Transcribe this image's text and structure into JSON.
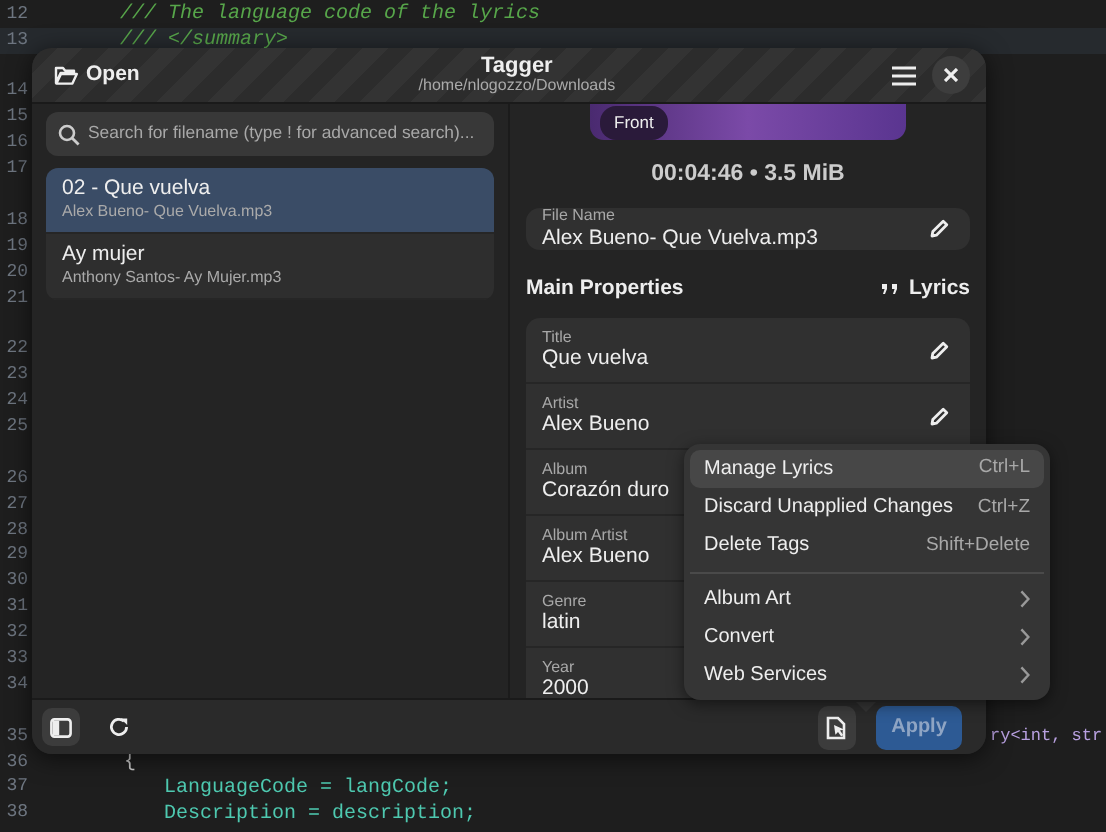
{
  "editor": {
    "lines": [
      {
        "kind": "comment",
        "number": "12",
        "code": "/// The language code of the lyrics",
        "current": false
      },
      {
        "kind": "summary",
        "number": "13",
        "code": "/// </summary>",
        "current": true
      },
      {
        "kind": "gap"
      },
      {
        "kind": "hidden",
        "number": "14"
      },
      {
        "kind": "hidden",
        "number": "15"
      },
      {
        "kind": "hidden",
        "number": "16"
      },
      {
        "kind": "hidden",
        "number": "17"
      },
      {
        "kind": "gap"
      },
      {
        "kind": "hidden",
        "number": "18"
      },
      {
        "kind": "hidden",
        "number": "19"
      },
      {
        "kind": "hidden",
        "number": "20"
      },
      {
        "kind": "hidden",
        "number": "21"
      },
      {
        "kind": "gap"
      },
      {
        "kind": "hidden",
        "number": "22"
      },
      {
        "kind": "hidden",
        "number": "23"
      },
      {
        "kind": "hidden",
        "number": "24"
      },
      {
        "kind": "hidden",
        "number": "25"
      },
      {
        "kind": "gap"
      },
      {
        "kind": "hidden",
        "number": "26"
      },
      {
        "kind": "hidden",
        "number": "27"
      },
      {
        "kind": "hidden",
        "number": "28"
      },
      {
        "kind": "hidden",
        "number": "29"
      },
      {
        "kind": "hidden",
        "number": "30"
      },
      {
        "kind": "hidden",
        "number": "31"
      },
      {
        "kind": "hidden",
        "number": "32"
      },
      {
        "kind": "hidden",
        "number": "33"
      },
      {
        "kind": "hidden",
        "number": "34"
      },
      {
        "kind": "gap"
      },
      {
        "kind": "tail",
        "number": "35",
        "code": "ry<int, str",
        "current": false
      },
      {
        "kind": "brace",
        "number": "36",
        "code": "{",
        "current": false
      },
      {
        "kind": "statement",
        "number": "37",
        "code": "LanguageCode = langCode;",
        "current": false
      },
      {
        "kind": "statement",
        "number": "38",
        "code": "Description = description;",
        "current": false
      }
    ]
  },
  "window": {
    "title": "Tagger",
    "subtitle": "/home/nlogozzo/Downloads",
    "open_button": "Open"
  },
  "search": {
    "placeholder": "Search for filename (type ! for advanced search)..."
  },
  "files": [
    {
      "title": "02 - Que vuelva",
      "subtitle": "Alex Bueno- Que Vuelva.mp3",
      "selected": true
    },
    {
      "title": "Ay mujer",
      "subtitle": "Anthony Santos- Ay Mujer.mp3",
      "selected": false
    }
  ],
  "album_art": {
    "badge": "Front"
  },
  "info": "00:04:46 • 3.5 MiB",
  "file_name": {
    "label": "File Name",
    "value": "Alex Bueno- Que Vuelva.mp3"
  },
  "section": {
    "title": "Main Properties",
    "lyrics_button": "Lyrics"
  },
  "properties": [
    {
      "label": "Title",
      "value": "Que vuelva"
    },
    {
      "label": "Artist",
      "value": "Alex Bueno"
    },
    {
      "label": "Album",
      "value": "Corazón duro"
    },
    {
      "label": "Album Artist",
      "value": "Alex Bueno"
    },
    {
      "label": "Genre",
      "value": "latin"
    },
    {
      "label": "Year",
      "value": "2000"
    }
  ],
  "menu": {
    "items": [
      {
        "kind": "action",
        "label": "Manage Lyrics",
        "shortcut": "Ctrl+L",
        "highlighted": true
      },
      {
        "kind": "action",
        "label": "Discard Unapplied Changes",
        "shortcut": "Ctrl+Z",
        "highlighted": false
      },
      {
        "kind": "action",
        "label": "Delete Tags",
        "shortcut": "Shift+Delete",
        "highlighted": false
      },
      {
        "kind": "separator"
      },
      {
        "kind": "submenu",
        "label": "Album Art",
        "highlighted": false
      },
      {
        "kind": "submenu",
        "label": "Convert",
        "highlighted": false
      },
      {
        "kind": "submenu",
        "label": "Web Services",
        "highlighted": false
      }
    ]
  },
  "bottom_bar": {
    "sidebar_toggle_on": true,
    "apply_button": "Apply",
    "apply_disabled": true
  }
}
